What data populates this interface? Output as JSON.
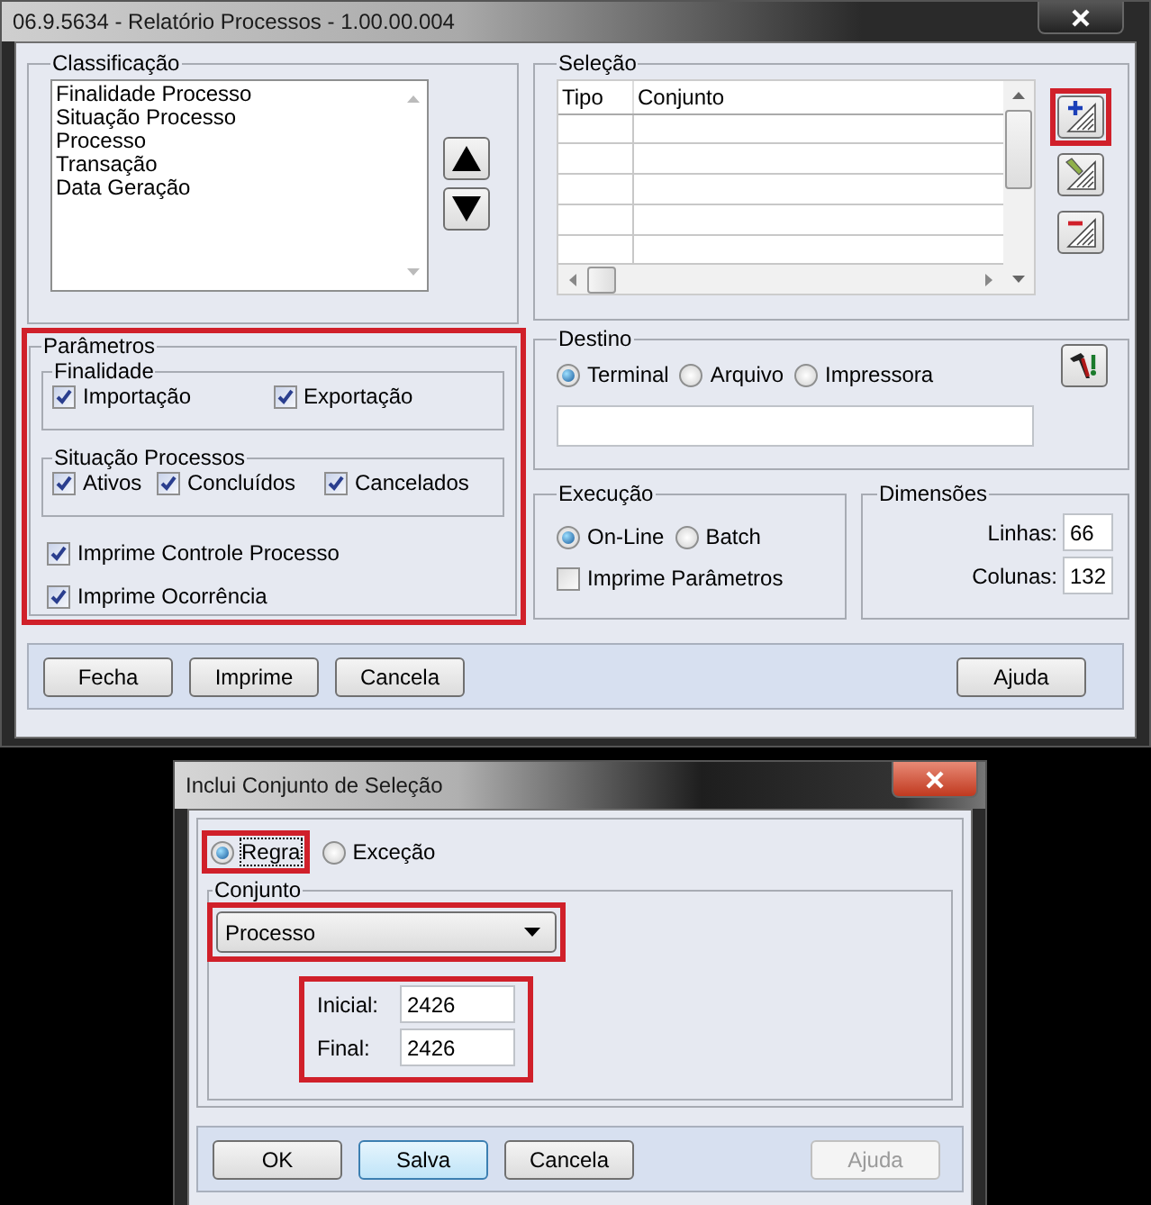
{
  "main_window": {
    "title": "06.9.5634 - Relatório Processos - 1.00.00.004",
    "classificacao": {
      "label": "Classificação",
      "items": [
        "Finalidade Processo",
        "Situação Processo",
        "Processo",
        "Transação",
        "Data Geração"
      ]
    },
    "selecao": {
      "label": "Seleção",
      "columns": [
        "Tipo",
        "Conjunto"
      ],
      "tools": [
        {
          "kind": "add",
          "highlighted": true
        },
        {
          "kind": "edit",
          "highlighted": false
        },
        {
          "kind": "remove",
          "highlighted": false
        }
      ]
    },
    "parametros": {
      "label": "Parâmetros",
      "highlighted": true,
      "groups": [
        {
          "label": "Finalidade",
          "options": [
            {
              "label": "Importação",
              "checked": true
            },
            {
              "label": "Exportação",
              "checked": true
            }
          ]
        },
        {
          "label": "Situação Processos",
          "options": [
            {
              "label": "Ativos",
              "checked": true
            },
            {
              "label": "Concluídos",
              "checked": true
            },
            {
              "label": "Cancelados",
              "checked": true
            }
          ]
        }
      ],
      "options": [
        {
          "label": "Imprime Controle Processo",
          "checked": true
        },
        {
          "label": "Imprime Ocorrência",
          "checked": true
        }
      ]
    },
    "destino": {
      "label": "Destino",
      "options": [
        {
          "label": "Terminal",
          "selected": true
        },
        {
          "label": "Arquivo",
          "selected": false
        },
        {
          "label": "Impressora",
          "selected": false
        }
      ]
    },
    "execucao": {
      "label": "Execução",
      "options": [
        {
          "label": "On-Line",
          "selected": true
        },
        {
          "label": "Batch",
          "selected": false
        }
      ],
      "checkbox": {
        "label": "Imprime Parâmetros",
        "checked": false
      }
    },
    "dimensoes": {
      "label": "Dimensões",
      "fields": [
        {
          "label": "Linhas:",
          "value": "66"
        },
        {
          "label": "Colunas:",
          "value": "132"
        }
      ]
    },
    "buttons": [
      "Fecha",
      "Imprime",
      "Cancela"
    ],
    "help_button": "Ajuda"
  },
  "dialog": {
    "title": "Inclui Conjunto de Seleção",
    "type_options": [
      {
        "label": "Regra",
        "selected": true,
        "highlighted": true
      },
      {
        "label": "Exceção",
        "selected": false,
        "highlighted": false
      }
    ],
    "conjunto": {
      "label": "Conjunto",
      "value": "Processo",
      "highlighted": true
    },
    "range": {
      "highlighted": true,
      "fields": [
        {
          "label": "Inicial:",
          "value": "2426"
        },
        {
          "label": "Final:",
          "value": "2426"
        }
      ]
    },
    "buttons": [
      {
        "label": "OK",
        "focused": false
      },
      {
        "label": "Salva",
        "focused": true
      },
      {
        "label": "Cancela",
        "focused": false
      }
    ],
    "help_button": {
      "label": "Ajuda",
      "disabled": true
    }
  }
}
